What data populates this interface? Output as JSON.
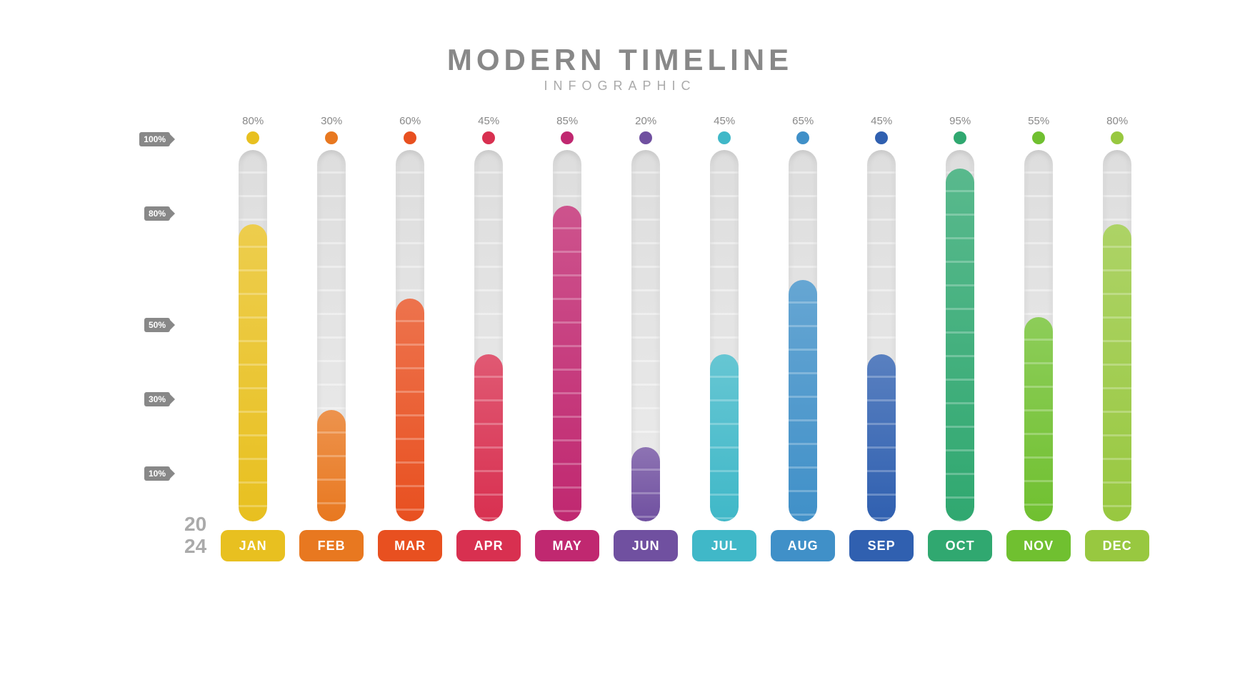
{
  "title": "MODERN TIMELINE",
  "subtitle": "INFOGRAPHIC",
  "year": "20\n24",
  "y_labels": [
    "100%",
    "80%",
    "50%",
    "30%",
    "10%"
  ],
  "bar_total_height": 520,
  "months": [
    {
      "label": "JAN",
      "percent": 80,
      "color": "#E8C020",
      "dot_color": "#E8C020",
      "badge_color": "#E8C020"
    },
    {
      "label": "FEB",
      "percent": 30,
      "color": "#E87820",
      "dot_color": "#E87820",
      "badge_color": "#E87820"
    },
    {
      "label": "MAR",
      "percent": 60,
      "color": "#E85020",
      "dot_color": "#E85020",
      "badge_color": "#E85020"
    },
    {
      "label": "APR",
      "percent": 45,
      "color": "#D83050",
      "dot_color": "#D83050",
      "badge_color": "#D83050"
    },
    {
      "label": "MAY",
      "percent": 85,
      "color": "#C02870",
      "dot_color": "#C02870",
      "badge_color": "#C02870"
    },
    {
      "label": "JUN",
      "percent": 20,
      "color": "#7050A0",
      "dot_color": "#7050A0",
      "badge_color": "#7050A0"
    },
    {
      "label": "JUL",
      "percent": 45,
      "color": "#40B8C8",
      "dot_color": "#40B8C8",
      "badge_color": "#40B8C8"
    },
    {
      "label": "AUG",
      "percent": 65,
      "color": "#4090C8",
      "dot_color": "#4090C8",
      "badge_color": "#4090C8"
    },
    {
      "label": "SEP",
      "percent": 45,
      "color": "#3060B0",
      "dot_color": "#3060B0",
      "badge_color": "#3060B0"
    },
    {
      "label": "OCT",
      "percent": 95,
      "color": "#30A870",
      "dot_color": "#30A870",
      "badge_color": "#30A870"
    },
    {
      "label": "NOV",
      "percent": 55,
      "color": "#70C030",
      "dot_color": "#70C030",
      "badge_color": "#70C030"
    },
    {
      "label": "DEC",
      "percent": 80,
      "color": "#98C840",
      "dot_color": "#98C840",
      "badge_color": "#98C840"
    }
  ]
}
